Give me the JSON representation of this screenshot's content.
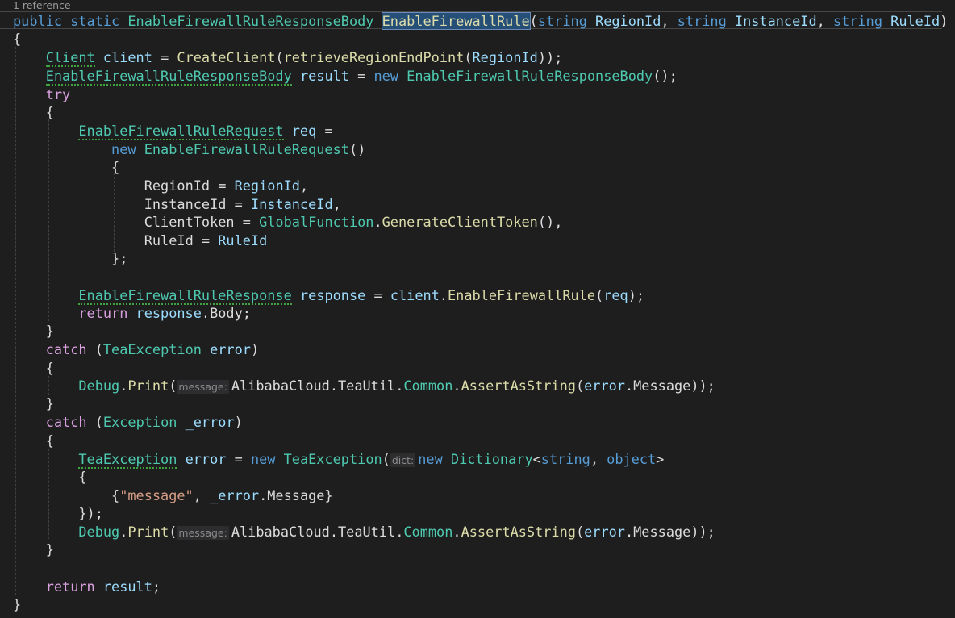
{
  "codelens": "1 reference",
  "tokens": {
    "public": "public",
    "static": "static",
    "string": "string",
    "object": "object",
    "new": "new",
    "try": "try",
    "catch": "catch",
    "return": "return",
    "resp_body_type": "EnableFirewallRuleResponseBody",
    "method_name": "EnableFirewallRule",
    "p_region": "RegionId",
    "p_instance": "InstanceId",
    "p_rule": "RuleId",
    "client_type": "Client",
    "client_var": "client",
    "create_client": "CreateClient",
    "retrieve_fn": "retrieveRegionEndPoint",
    "result_var": "result",
    "req_type": "EnableFirewallRuleRequest",
    "req_var": "req",
    "region_prop": "RegionId",
    "instance_prop": "InstanceId",
    "client_token_prop": "ClientToken",
    "global_fn": "GlobalFunction",
    "gen_token": "GenerateClientToken",
    "rule_prop": "RuleId",
    "response_type": "EnableFirewallRuleResponse",
    "response_var": "response",
    "body_prop": "Body",
    "tea_exception": "TeaException",
    "error_var": "error",
    "debug": "Debug",
    "print": "Print",
    "alibaba": "AlibabaCloud",
    "teautil": "TeaUtil",
    "common": "Common",
    "assert_fn": "AssertAsString",
    "message_prop": "Message",
    "exception": "Exception",
    "uerror_var": "_error",
    "dictionary": "Dictionary",
    "message_str": "\"message\""
  },
  "hints": {
    "message": "message:",
    "dict": "dict:"
  }
}
